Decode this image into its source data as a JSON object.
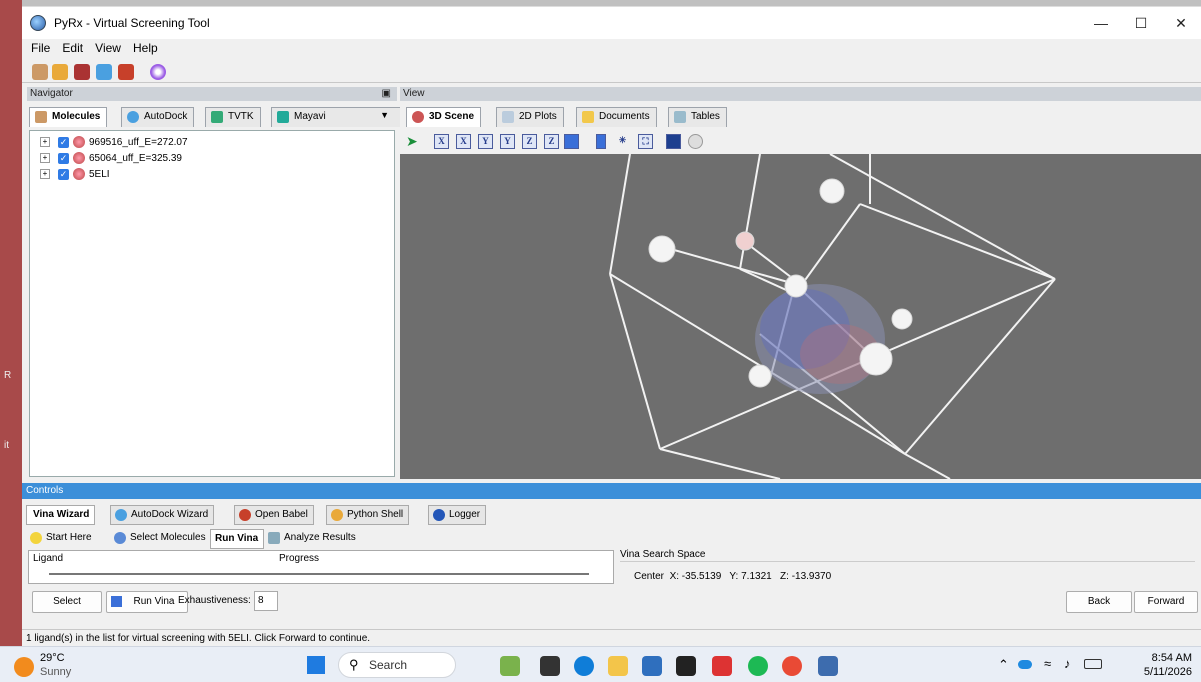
{
  "window": {
    "title": "PyRx - Virtual Screening Tool"
  },
  "menu": [
    "File",
    "Edit",
    "View",
    "Help"
  ],
  "navigator": {
    "header": "Navigator",
    "tabs": [
      "Molecules",
      "AutoDock",
      "TVTK",
      "Mayavi"
    ],
    "tree": [
      "969516_uff_E=272.07",
      "65064_uff_E=325.39",
      "5ELI"
    ]
  },
  "view": {
    "header": "View",
    "tabs": [
      "3D Scene",
      "2D Plots",
      "Documents",
      "Tables"
    ],
    "toolbar_letters": [
      "X",
      "X",
      "Y",
      "Y",
      "Z",
      "Z"
    ]
  },
  "controls": {
    "header": "Controls",
    "tabs": [
      "Vina Wizard",
      "AutoDock Wizard",
      "Open Babel",
      "Python Shell",
      "Logger"
    ],
    "subtabs": [
      "Start Here",
      "Select Molecules",
      "Run Vina",
      "Analyze Results"
    ],
    "table_headers": [
      "Ligand",
      "Progress"
    ],
    "search_space_label": "Vina Search Space",
    "center_text": "Center  X: -35.5139   Y: 7.1321   Z: -13.9370",
    "select_label": "Select",
    "run_vina_label": "Run Vina",
    "exhaustiveness_label": "Exhaustiveness:",
    "exhaustiveness_value": "8",
    "back_label": "Back",
    "forward_label": "Forward"
  },
  "status": "1 ligand(s) in the list for virtual screening with 5ELI. Click Forward to continue.",
  "taskbar": {
    "temp": "29°C",
    "weather": "Sunny",
    "search_placeholder": "Search",
    "time": "8:54 AM",
    "date": "5/11/2026"
  },
  "colors": {
    "scene_bg": "#6e6e6e",
    "controls_header": "#3c8fd9",
    "left_strip": "#a84a4a"
  }
}
